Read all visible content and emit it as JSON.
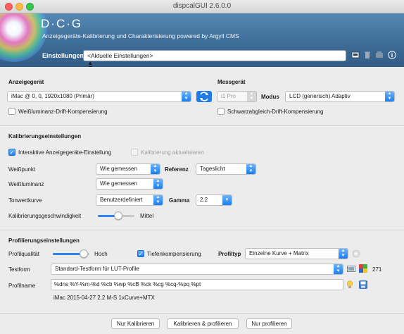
{
  "window": {
    "title": "dispcalGUI 2.6.0.0"
  },
  "banner": {
    "title": "D·C·G",
    "subtitle": "Anzeigegeräte-Kalibrierung und Charakterisierung powered by Argyll CMS",
    "settings_label": "Einstellungen",
    "settings_value": "<Aktuelle Einstellungen>"
  },
  "display": {
    "heading": "Anzeigegerät",
    "device": "iMac @ 0, 0, 1920x1080 (Primär)",
    "white_drift": "Weißluminanz-Drift-Kompensierung"
  },
  "instrument": {
    "heading": "Messgerät",
    "device": "i1 Pro",
    "mode_label": "Modus",
    "mode": "LCD (generisch) Adaptiv",
    "black_drift": "Schwarzabgleich-Drift-Kompensierung"
  },
  "calibration": {
    "heading": "Kalibrierungseinstellungen",
    "interactive": "Interaktive Anzeigegeräte-Einstellung",
    "interactive_checked": true,
    "update": "Kalibrierung aktualisieren",
    "whitepoint_label": "Weißpunkt",
    "whitepoint": "Wie gemessen",
    "reference_label": "Referenz",
    "reference": "Tageslicht",
    "luminance_label": "Weißluminanz",
    "luminance": "Wie gemessen",
    "tonecurve_label": "Tonwertkurve",
    "tonecurve": "Benutzerdefiniert",
    "gamma_label": "Gamma",
    "gamma": "2.2",
    "speed_label": "Kalibrierungsgeschwindigkeit",
    "speed_value": "Mittel",
    "speed_level": 0.55
  },
  "profiling": {
    "heading": "Profilierungseinstellungen",
    "quality_label": "Profilqualität",
    "quality_value": "Hoch",
    "quality_level": 0.85,
    "depth_comp": "Tiefenkompensierung",
    "depth_comp_checked": true,
    "profile_type_label": "Profiltyp",
    "profile_type": "Einzelne Kurve + Matrix",
    "testchart_label": "Testform",
    "testchart": "Standard-Testform für LUT-Profile",
    "testchart_count": "271",
    "profile_name_label": "Profilname",
    "profile_name": "%dns %Y-%m-%d %cb %wp %cB %ck %cg %cq-%pq %pt",
    "profile_name_preview": "iMac 2015-04-27 2.2 M-S 1xCurve+MTX"
  },
  "actions": {
    "calibrate_only": "Nur Kalibrieren",
    "calibrate_profile": "Kalibrieren & profilieren",
    "profile_only": "Nur profilieren"
  },
  "colors": {
    "accent": "#1d7ff0",
    "banner": "#3e6d97"
  }
}
